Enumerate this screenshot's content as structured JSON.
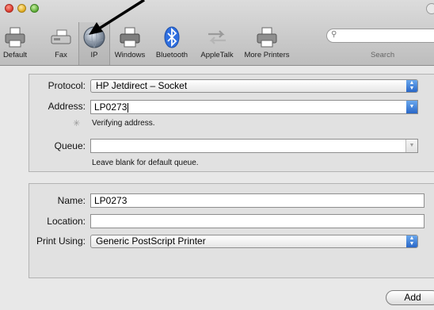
{
  "toolbar": {
    "items": [
      {
        "label": "Default",
        "icon": "printer-icon"
      },
      {
        "label": "Fax",
        "icon": "fax-icon"
      },
      {
        "label": "IP",
        "icon": "globe-icon"
      },
      {
        "label": "Windows",
        "icon": "windows-printer-icon"
      },
      {
        "label": "Bluetooth",
        "icon": "bluetooth-icon"
      },
      {
        "label": "AppleTalk",
        "icon": "appletalk-icon"
      },
      {
        "label": "More Printers",
        "icon": "printer-icon"
      }
    ],
    "search_label": "Search"
  },
  "connection": {
    "protocol_label": "Protocol:",
    "protocol_value": "HP Jetdirect – Socket",
    "address_label": "Address:",
    "address_value": "LP0273",
    "verifying_text": "Verifying address.",
    "queue_label": "Queue:",
    "queue_value": "",
    "queue_hint": "Leave blank for default queue."
  },
  "printer": {
    "name_label": "Name:",
    "name_value": "LP0273",
    "location_label": "Location:",
    "location_value": "",
    "print_using_label": "Print Using:",
    "print_using_value": "Generic PostScript Printer"
  },
  "add_button": "Add"
}
